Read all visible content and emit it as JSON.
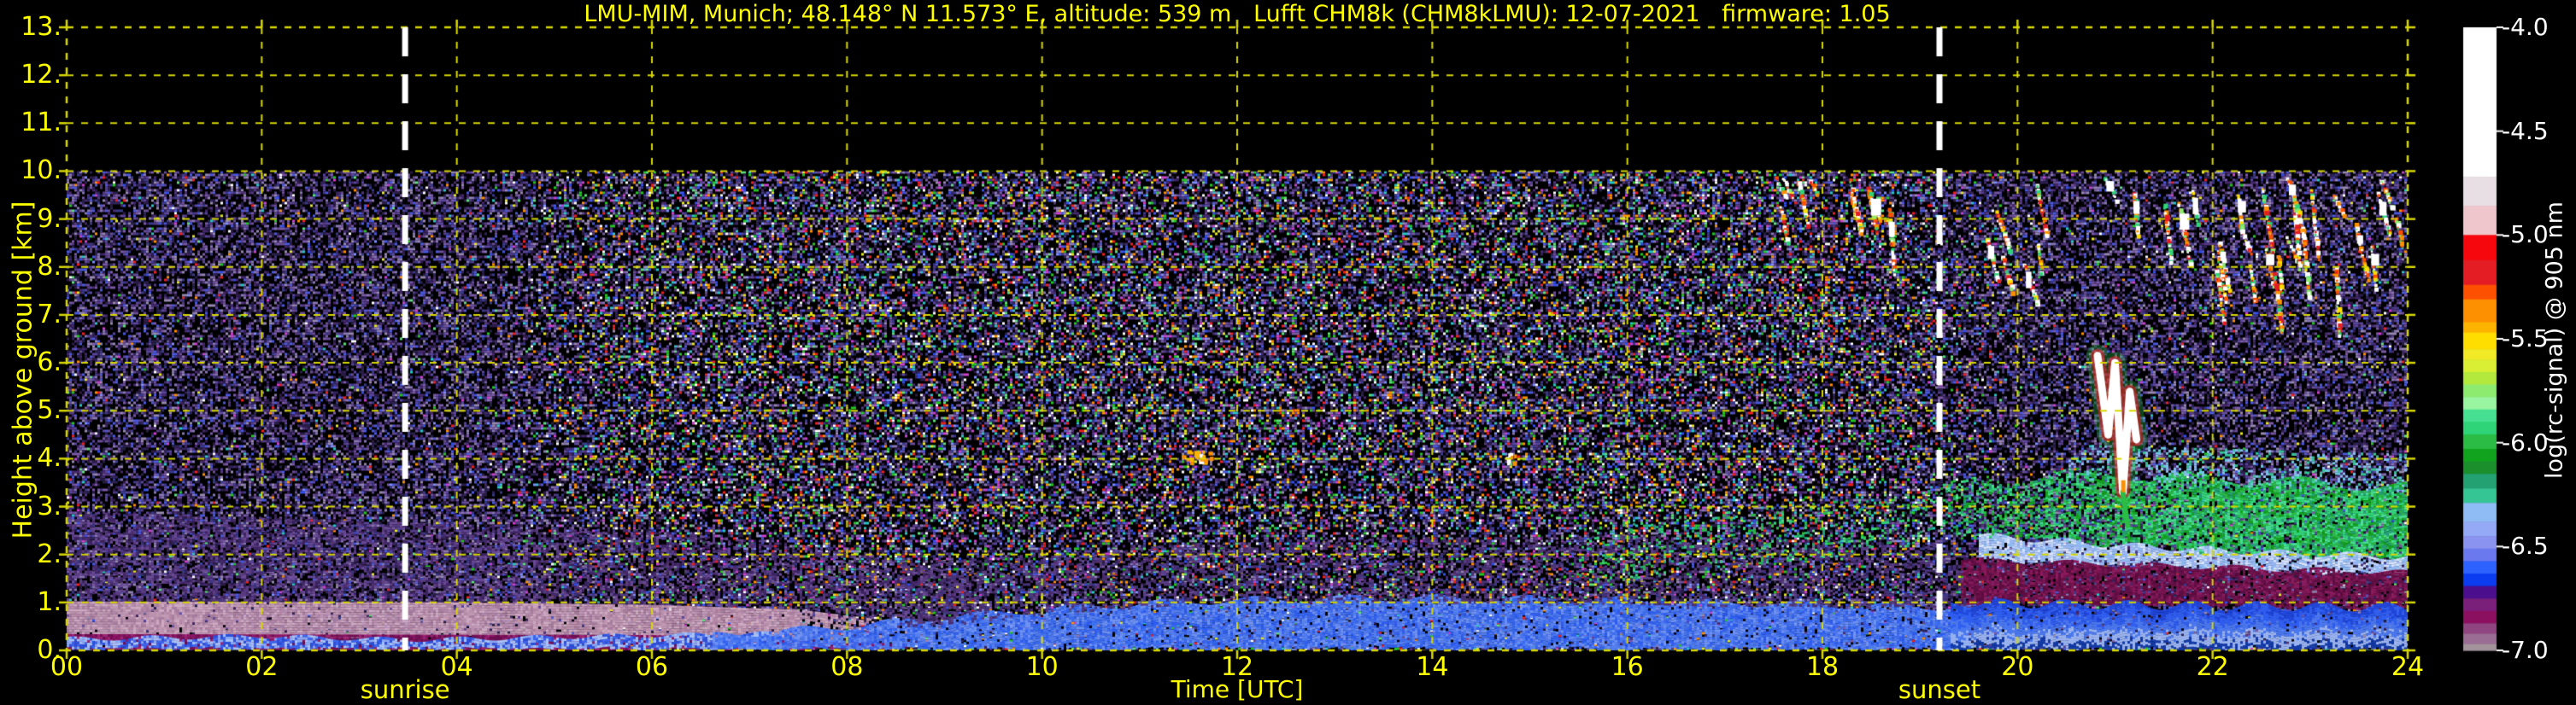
{
  "page": {
    "background": "#000000",
    "text_yellow": "#ffff00",
    "text_white": "#ffffff",
    "grid_color": "#d8d800"
  },
  "chart_data": {
    "type": "heatmap",
    "title": "LMU-MIM, Munich; 48.148° N 11.573° E, altitude: 539 m   Lufft CHM8k (CHM8kLMU): 12-07-2021   firmware: 1.05",
    "xlabel": "Time [UTC]",
    "ylabel": "Height above ground [km]",
    "x_range_hours": [
      0,
      24
    ],
    "y_range_km": [
      0,
      13
    ],
    "data_top_km": 10,
    "grid": {
      "x_step_hours": 2,
      "y_step_km": 1,
      "style": "dashed-yellow"
    },
    "x_ticks": [
      {
        "h": 0,
        "label": "00"
      },
      {
        "h": 2,
        "label": "02"
      },
      {
        "h": 4,
        "label": "04"
      },
      {
        "h": 6,
        "label": "06"
      },
      {
        "h": 8,
        "label": "08"
      },
      {
        "h": 10,
        "label": "10"
      },
      {
        "h": 12,
        "label": "12"
      },
      {
        "h": 14,
        "label": "14"
      },
      {
        "h": 16,
        "label": "16"
      },
      {
        "h": 18,
        "label": "18"
      },
      {
        "h": 20,
        "label": "20"
      },
      {
        "h": 22,
        "label": "22"
      },
      {
        "h": 24,
        "label": "24"
      }
    ],
    "y_ticks": [
      {
        "km": 0,
        "label": "0."
      },
      {
        "km": 1,
        "label": "1."
      },
      {
        "km": 2,
        "label": "2."
      },
      {
        "km": 3,
        "label": "3."
      },
      {
        "km": 4,
        "label": "4."
      },
      {
        "km": 5,
        "label": "5."
      },
      {
        "km": 6,
        "label": "6."
      },
      {
        "km": 7,
        "label": "7."
      },
      {
        "km": 8,
        "label": "8."
      },
      {
        "km": 9,
        "label": "9."
      },
      {
        "km": 10,
        "label": "10."
      },
      {
        "km": 11,
        "label": "11."
      },
      {
        "km": 12,
        "label": "12."
      },
      {
        "km": 13,
        "label": "13."
      }
    ],
    "events": {
      "sunrise": {
        "label": "sunrise",
        "time_utc": 3.47
      },
      "sunset": {
        "label": "sunset",
        "time_utc": 19.2
      },
      "line_style": "white-dashed"
    },
    "colorbar": {
      "label": "log(rc-signal) @ 905 nm",
      "range": [
        -7.0,
        -4.0
      ],
      "ticks": [
        {
          "v": -4.0,
          "label": "-4.0"
        },
        {
          "v": -4.5,
          "label": "-4.5"
        },
        {
          "v": -5.0,
          "label": "-5.0"
        },
        {
          "v": -5.5,
          "label": "-5.5"
        },
        {
          "v": -6.0,
          "label": "-6.0"
        },
        {
          "v": -6.5,
          "label": "-6.5"
        },
        {
          "v": -7.0,
          "label": "-7.0"
        }
      ],
      "segments": [
        {
          "from": -4.0,
          "to": -4.72,
          "color": "#ffffff"
        },
        {
          "from": -4.72,
          "to": -4.86,
          "color": "#e8dfe4"
        },
        {
          "from": -4.86,
          "to": -5.0,
          "color": "#eec6cc"
        },
        {
          "from": -5.0,
          "to": -5.12,
          "color": "#f5070d"
        },
        {
          "from": -5.12,
          "to": -5.24,
          "color": "#e41d24"
        },
        {
          "from": -5.24,
          "to": -5.31,
          "color": "#fd5000"
        },
        {
          "from": -5.31,
          "to": -5.42,
          "color": "#fc9000"
        },
        {
          "from": -5.42,
          "to": -5.47,
          "color": "#fcb400"
        },
        {
          "from": -5.47,
          "to": -5.55,
          "color": "#fede00"
        },
        {
          "from": -5.55,
          "to": -5.6,
          "color": "#f2ea26"
        },
        {
          "from": -5.6,
          "to": -5.66,
          "color": "#d8ef33"
        },
        {
          "from": -5.66,
          "to": -5.72,
          "color": "#b2e93c"
        },
        {
          "from": -5.72,
          "to": -5.78,
          "color": "#8deb70"
        },
        {
          "from": -5.78,
          "to": -5.84,
          "color": "#9af5a0"
        },
        {
          "from": -5.84,
          "to": -5.9,
          "color": "#47e092"
        },
        {
          "from": -5.9,
          "to": -5.96,
          "color": "#2fd478"
        },
        {
          "from": -5.96,
          "to": -6.03,
          "color": "#2abc45"
        },
        {
          "from": -6.03,
          "to": -6.09,
          "color": "#12a31e"
        },
        {
          "from": -6.09,
          "to": -6.15,
          "color": "#1b8f2b"
        },
        {
          "from": -6.15,
          "to": -6.22,
          "color": "#23a173"
        },
        {
          "from": -6.22,
          "to": -6.29,
          "color": "#35c493"
        },
        {
          "from": -6.29,
          "to": -6.38,
          "color": "#8fbcf4"
        },
        {
          "from": -6.38,
          "to": -6.45,
          "color": "#95aaf6"
        },
        {
          "from": -6.45,
          "to": -6.51,
          "color": "#8b93f0"
        },
        {
          "from": -6.51,
          "to": -6.57,
          "color": "#6b79ee"
        },
        {
          "from": -6.57,
          "to": -6.63,
          "color": "#2e62ff"
        },
        {
          "from": -6.63,
          "to": -6.69,
          "color": "#0b3cf0"
        },
        {
          "from": -6.69,
          "to": -6.75,
          "color": "#4b0f8e"
        },
        {
          "from": -6.75,
          "to": -6.81,
          "color": "#7a1f7a"
        },
        {
          "from": -6.81,
          "to": -6.87,
          "color": "#8c1060"
        },
        {
          "from": -6.87,
          "to": -6.92,
          "color": "#8f4580"
        },
        {
          "from": -6.92,
          "to": -6.97,
          "color": "#9a6e94"
        },
        {
          "from": -6.97,
          "to": -7.0,
          "color": "#a3949c"
        }
      ]
    },
    "noise": {
      "night_colors": [
        "#46286e",
        "#553a82",
        "#2e1c4a",
        "#6a4e96",
        "#3a3a8c",
        "#8878b4",
        "#30245c",
        "#5a46a0",
        "#262046",
        "#7c5aa8",
        "#4a5ae0",
        "#988ab0"
      ],
      "day_colors": [
        "#f02020",
        "#22c822",
        "#3050f0",
        "#28c8c8",
        "#e8e828",
        "#ffffff",
        "#ff9000",
        "#d040d0",
        "#60e080",
        "#8090ff"
      ],
      "fill_probability": 0.55,
      "bright_probability_night": 0.05,
      "bright_probability_day_extra": 0.32
    },
    "features": {
      "day_window": {
        "start": 4.3,
        "end": 20.0,
        "ramp": 1.4
      },
      "layers": [
        {
          "name": "night-purple-haze",
          "t": [
            0,
            9.4
          ],
          "top": [
            [
              0,
              2.9
            ],
            [
              3,
              2.7
            ],
            [
              6,
              2.5
            ],
            [
              8,
              2.1
            ],
            [
              9.4,
              1.5
            ]
          ],
          "bottom": [
            [
              0,
              1.0
            ],
            [
              9.4,
              0.6
            ]
          ],
          "colors": [
            "#5a3c82",
            "#4a2c6e",
            "#6a4a96",
            "#3c2460"
          ],
          "density": 0.38
        },
        {
          "name": "nocturnal-aerosol-pink-band",
          "t": [
            0,
            9.2
          ],
          "top": [
            [
              0,
              1.02
            ],
            [
              4,
              1.0
            ],
            [
              6,
              0.95
            ],
            [
              7.5,
              0.85
            ],
            [
              8.5,
              0.6
            ],
            [
              9.2,
              0.35
            ]
          ],
          "bottom": [
            [
              0,
              0.32
            ],
            [
              6,
              0.3
            ],
            [
              9.2,
              0.12
            ]
          ],
          "colors": [
            "#c29ab4",
            "#b488a6",
            "#cfaac2",
            "#a87e9e",
            "#bb92ae"
          ],
          "density": 0.96,
          "fade": [
            7.2,
            9.2
          ]
        },
        {
          "name": "magenta-surface-layer",
          "t": [
            0,
            8.6
          ],
          "top": [
            [
              0,
              0.34
            ],
            [
              6,
              0.32
            ],
            [
              8.6,
              0.14
            ]
          ],
          "bottom": [
            [
              0,
              0.05
            ]
          ],
          "colors": [
            "#8c1464",
            "#7a1058",
            "#9c2474",
            "#6e0c50"
          ],
          "density": 0.97
        },
        {
          "name": "night-ground-blue-line",
          "t": [
            0,
            7.2
          ],
          "top": [
            [
              0,
              0.24
            ],
            [
              2,
              0.3
            ],
            [
              3.5,
              0.22
            ],
            [
              5,
              0.28
            ],
            [
              7.2,
              0.35
            ]
          ],
          "bottom": [
            [
              0,
              0.06
            ]
          ],
          "colors": [
            "#3a66f0",
            "#88aaf4",
            "#2850dc",
            "#a8c4f8"
          ],
          "density": 0.92,
          "wave": {
            "amp": 0.05,
            "freq": 2.1
          }
        },
        {
          "name": "daytime-boundary-layer-blue",
          "t": [
            6.6,
            19.5
          ],
          "top": [
            [
              6.6,
              0.3
            ],
            [
              8,
              0.5
            ],
            [
              9,
              0.7
            ],
            [
              10,
              0.85
            ],
            [
              11,
              0.98
            ],
            [
              12,
              1.05
            ],
            [
              13.5,
              1.1
            ],
            [
              15,
              1.08
            ],
            [
              16.5,
              1.02
            ],
            [
              18,
              0.95
            ],
            [
              19.5,
              0.9
            ]
          ],
          "bottom": [
            [
              6.6,
              0.05
            ]
          ],
          "colors": [
            "#2e5ef2",
            "#4a78f0",
            "#3a6af0",
            "#6e92f5",
            "#5580f2"
          ],
          "density": 0.92,
          "wave": {
            "amp": 0.08,
            "freq": 1.7
          }
        },
        {
          "name": "day-aerosol-purple-haze",
          "t": [
            8.5,
            19.5
          ],
          "top": [
            [
              8.5,
              1.8
            ],
            [
              12,
              2.3
            ],
            [
              16,
              2.4
            ],
            [
              19.5,
              2.2
            ]
          ],
          "bottom": [
            [
              8.5,
              0.5
            ],
            [
              12,
              1.05
            ],
            [
              19.5,
              0.9
            ]
          ],
          "colors": [
            "#5a3c82",
            "#4a2c6e",
            "#46347a"
          ],
          "density": 0.3
        },
        {
          "name": "pre-evening-green-speckle",
          "t": [
            15.5,
            19.0
          ],
          "top": [
            [
              15.5,
              2.6
            ],
            [
              19,
              3.3
            ]
          ],
          "bottom": [
            [
              15.5,
              1.4
            ],
            [
              19,
              2.2
            ]
          ],
          "colors": [
            "#2abc45",
            "#23a173",
            "#2fd478"
          ],
          "density": 0.14
        },
        {
          "name": "evening-elevated-green-layer",
          "t": [
            19.0,
            24
          ],
          "top": [
            [
              19,
              3.4
            ],
            [
              20.5,
              3.7
            ],
            [
              22,
              3.6
            ],
            [
              24,
              3.4
            ]
          ],
          "bottom": [
            [
              19,
              2.5
            ],
            [
              21,
              2.2
            ],
            [
              22.5,
              2.0
            ],
            [
              24,
              1.9
            ]
          ],
          "colors": [
            "#2abc45",
            "#23a173",
            "#2fd478",
            "#12a31e",
            "#47e092"
          ],
          "density_ramp": [
            [
              19,
              0.25
            ],
            [
              20.5,
              0.55
            ],
            [
              22,
              0.8
            ],
            [
              24,
              0.88
            ]
          ],
          "wave": {
            "amp": 0.12,
            "freq": 1.3
          }
        },
        {
          "name": "teal-fringe-above-green",
          "t": [
            20.5,
            24
          ],
          "top": [
            [
              20.5,
              4.3
            ],
            [
              24,
              4.1
            ]
          ],
          "bottom": [
            [
              20.5,
              3.6
            ],
            [
              24,
              3.3
            ]
          ],
          "colors": [
            "#35c493",
            "#6cc8e0",
            "#8fbcf4"
          ],
          "density": 0.22
        },
        {
          "name": "evening-light-blue-band",
          "t": [
            19.6,
            24
          ],
          "top": [
            [
              19.6,
              2.4
            ],
            [
              21,
              2.2
            ],
            [
              22.5,
              2.05
            ],
            [
              24,
              1.95
            ]
          ],
          "bottom": [
            [
              19.6,
              1.9
            ],
            [
              21,
              1.8
            ],
            [
              24,
              1.6
            ]
          ],
          "colors": [
            "#bcd2f8",
            "#9ab8f4",
            "#d8e4fb",
            "#8fbcf4"
          ],
          "density": 0.88,
          "wave": {
            "amp": 0.07,
            "freq": 2.3
          }
        },
        {
          "name": "evening-maroon-band",
          "t": [
            19.4,
            24
          ],
          "top": [
            [
              19.4,
              1.9
            ],
            [
              21,
              1.8
            ],
            [
              24,
              1.62
            ]
          ],
          "bottom": [
            [
              19.4,
              1.0
            ],
            [
              21,
              0.95
            ],
            [
              24,
              0.9
            ]
          ],
          "colors": [
            "#7a1450",
            "#690f46",
            "#8c1a5c",
            "#5e0c40"
          ],
          "density": 0.82,
          "wave": {
            "amp": 0.06,
            "freq": 1.9
          }
        },
        {
          "name": "evening-low-blue-layers",
          "t": [
            19.3,
            24
          ],
          "top": [
            [
              19.3,
              1.0
            ],
            [
              21,
              0.95
            ],
            [
              24,
              0.9
            ]
          ],
          "bottom": [
            [
              19.3,
              0.04
            ]
          ],
          "colors": [
            "#1e46dc",
            "#2e5ef2",
            "#4a78f0",
            "#9ab4f0",
            "#123aa8"
          ],
          "density": 0.94,
          "banded": true,
          "wave": {
            "amp": 0.1,
            "freq": 2.6
          }
        }
      ],
      "cirrus_clusters": [
        {
          "t": [
            17.3,
            18.75
          ],
          "km": [
            8.2,
            10.0
          ],
          "count": 10
        },
        {
          "t": [
            19.25,
            23.95
          ],
          "km": [
            6.8,
            10.0
          ],
          "count": 34
        }
      ],
      "cirrus_colors": [
        "#ffffff",
        "#fc9000",
        "#fd5000",
        "#e41d24",
        "#8deb70",
        "#fede00",
        "#2fd478"
      ],
      "mid_cloud": {
        "path": [
          [
            20.82,
            6.15
          ],
          [
            20.93,
            4.5
          ],
          [
            21.0,
            6.0
          ],
          [
            21.08,
            3.3
          ],
          [
            21.15,
            5.4
          ],
          [
            21.22,
            4.4
          ]
        ],
        "drip": [
          [
            21.08,
            3.3
          ],
          [
            21.13,
            2.6
          ]
        ],
        "core_color": "#ffffff",
        "edge_color": "#e41d24",
        "halo_color": "#2abc45"
      },
      "small_clouds": [
        [
          11.47,
          4.05
        ],
        [
          11.54,
          4.12
        ],
        [
          11.6,
          4.0
        ],
        [
          11.66,
          4.08
        ],
        [
          14.78,
          4.02
        ]
      ],
      "small_cloud_colors": [
        "#ffffff",
        "#fcb400",
        "#fc9000"
      ]
    }
  }
}
